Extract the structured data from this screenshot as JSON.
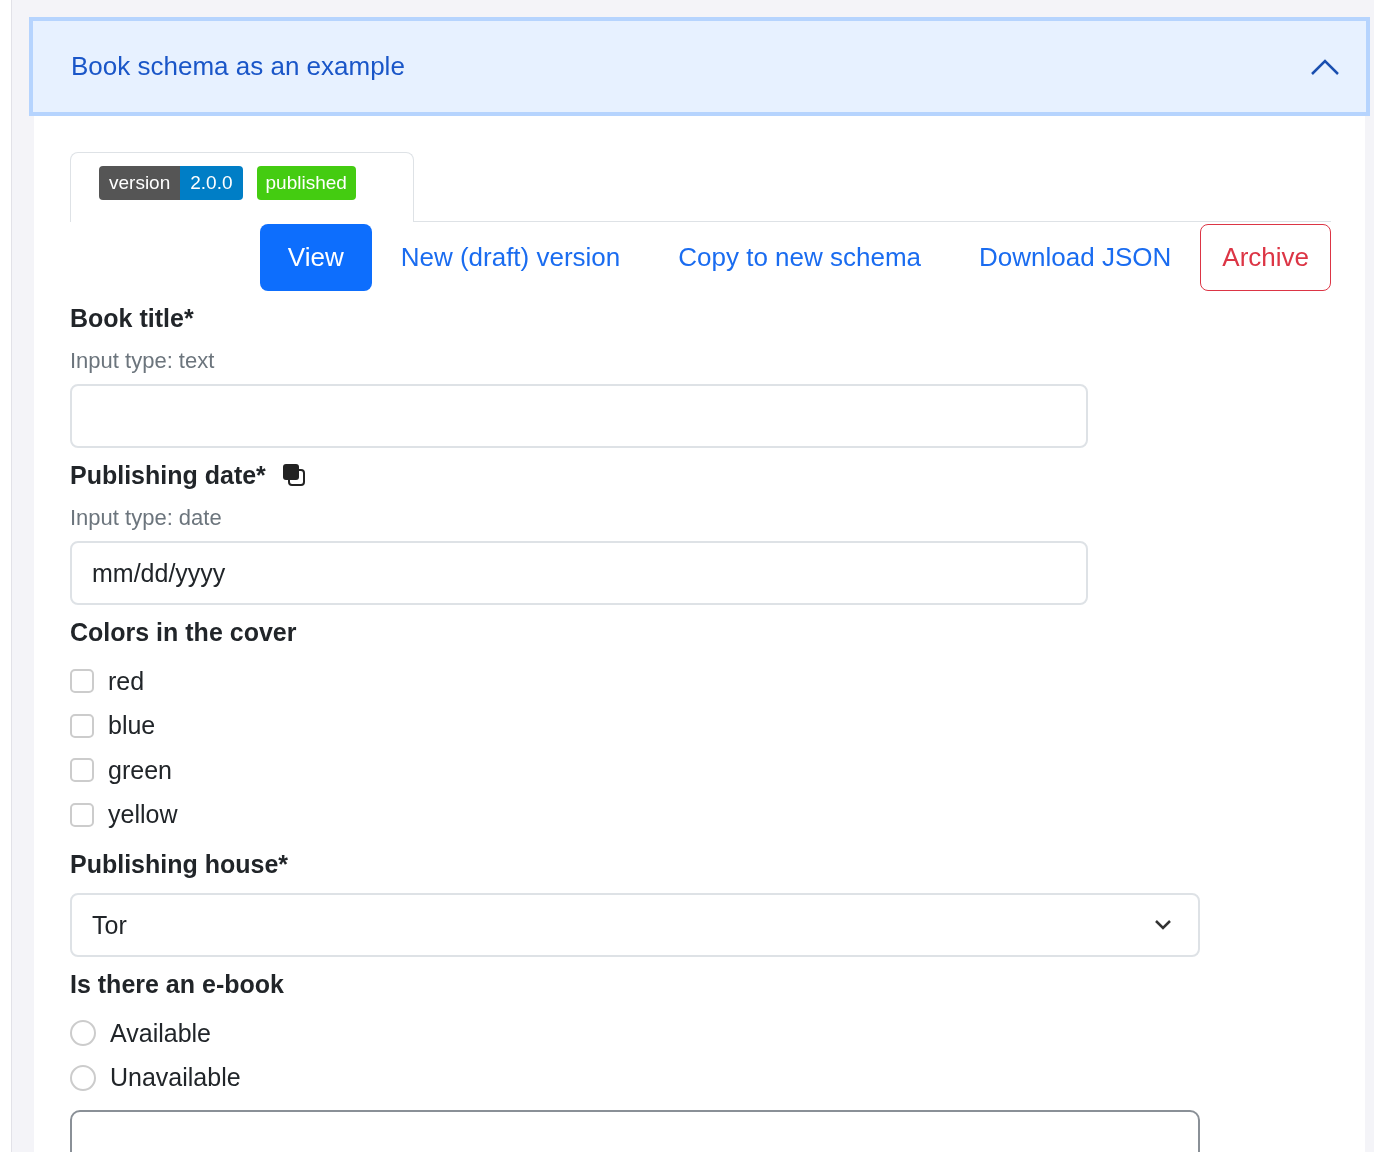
{
  "accordion": {
    "title": "Book schema as an example",
    "expanded": true
  },
  "badges": {
    "version_label": "version",
    "version": "2.0.0",
    "status": "published"
  },
  "actions": [
    {
      "label": "View",
      "kind": "primary"
    },
    {
      "label": "New (draft) version",
      "kind": "link"
    },
    {
      "label": "Copy to new schema",
      "kind": "link"
    },
    {
      "label": "Download JSON",
      "kind": "link"
    },
    {
      "label": "Archive",
      "kind": "danger"
    }
  ],
  "fields": [
    {
      "kind": "text",
      "label": "Book title*",
      "hint": "Input type: text"
    },
    {
      "kind": "date",
      "label": "Publishing date*",
      "copy_icon": true,
      "hint": "Input type: date",
      "placeholder": "mm/dd/yyyy"
    },
    {
      "kind": "checkboxes",
      "label": "Colors in the cover",
      "options": [
        {
          "label": "red",
          "checked": false
        },
        {
          "label": "blue",
          "checked": false
        },
        {
          "label": "green",
          "checked": false
        },
        {
          "label": "yellow",
          "checked": false
        }
      ]
    },
    {
      "kind": "select",
      "label": "Publishing house*",
      "value": "Tor"
    },
    {
      "kind": "radios",
      "label": "Is there an e-book",
      "options": [
        {
          "label": "Available",
          "selected": false
        },
        {
          "label": "Unavailable",
          "selected": false
        }
      ]
    },
    {
      "kind": "box"
    }
  ]
}
